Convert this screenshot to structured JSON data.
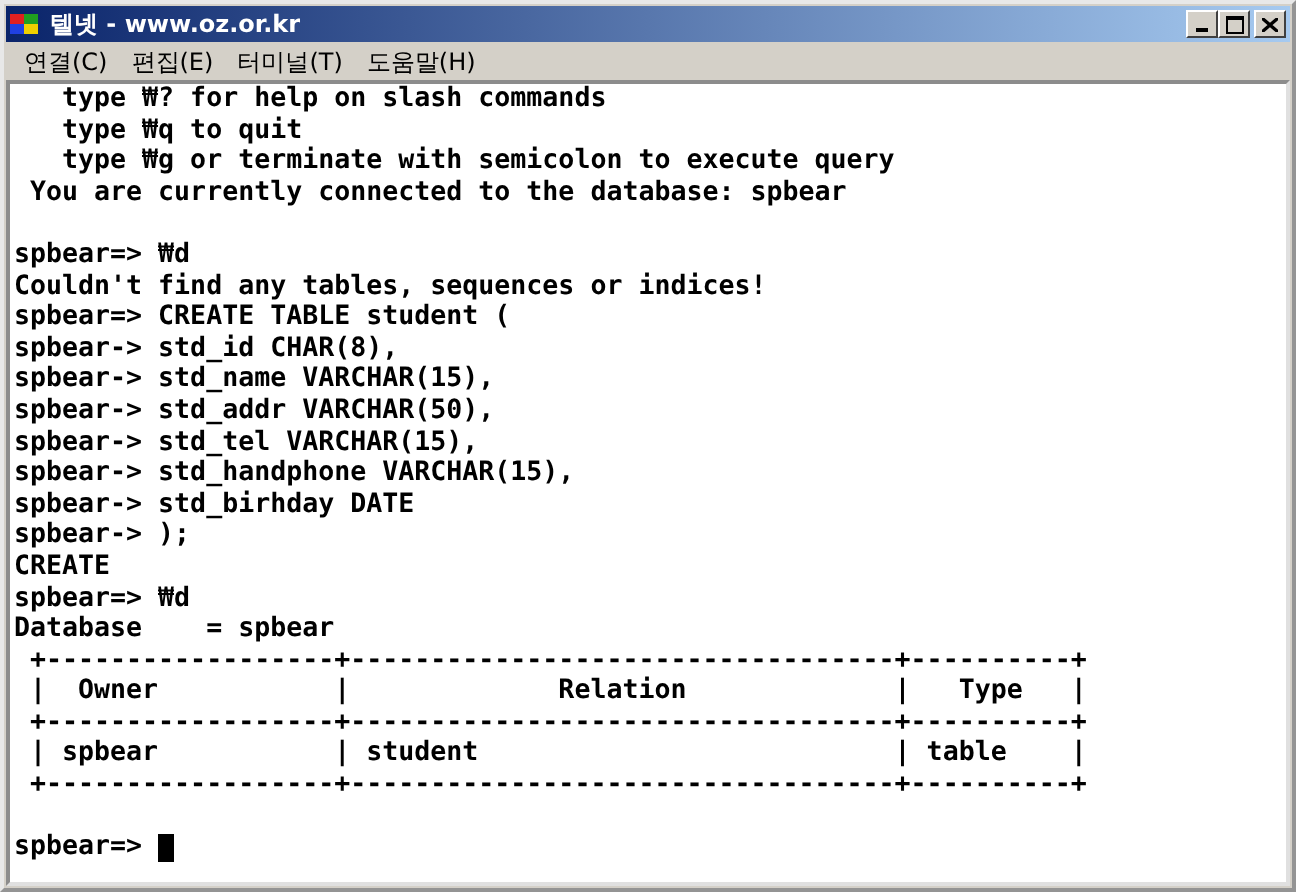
{
  "window": {
    "title": "텔넷 - www.oz.or.kr"
  },
  "menu": [
    {
      "label": "연결(C)"
    },
    {
      "label": "편집(E)"
    },
    {
      "label": "터미널(T)"
    },
    {
      "label": "도움말(H)"
    }
  ],
  "terminal": {
    "lines": [
      {
        "kind": "text",
        "text": "   type ₩? for help on slash commands"
      },
      {
        "kind": "text",
        "text": "   type ₩q to quit"
      },
      {
        "kind": "text",
        "text": "   type ₩g or terminate with semicolon to execute query"
      },
      {
        "kind": "text",
        "text": " You are currently connected to the database: spbear"
      },
      {
        "kind": "blank"
      },
      {
        "kind": "text",
        "text": "spbear=> ₩d"
      },
      {
        "kind": "text",
        "text": "Couldn't find any tables, sequences or indices!"
      },
      {
        "kind": "text",
        "text": "spbear=> CREATE TABLE student ("
      },
      {
        "kind": "text",
        "text": "spbear-> std_id CHAR(8),"
      },
      {
        "kind": "text",
        "text": "spbear-> std_name VARCHAR(15),"
      },
      {
        "kind": "text",
        "text": "spbear-> std_addr VARCHAR(50),"
      },
      {
        "kind": "text",
        "text": "spbear-> std_tel VARCHAR(15),"
      },
      {
        "kind": "text",
        "text": "spbear-> std_handphone VARCHAR(15),"
      },
      {
        "kind": "text",
        "text": "spbear-> std_birhday DATE"
      },
      {
        "kind": "text",
        "text": "spbear-> );"
      },
      {
        "kind": "text",
        "text": "CREATE"
      },
      {
        "kind": "text",
        "text": "spbear=> ₩d"
      },
      {
        "kind": "text",
        "text": "Database    = spbear"
      },
      {
        "kind": "text",
        "text": " +------------------+----------------------------------+----------+"
      },
      {
        "kind": "text",
        "text": " |  Owner           |             Relation             |   Type   |"
      },
      {
        "kind": "text",
        "text": " +------------------+----------------------------------+----------+"
      },
      {
        "kind": "text",
        "text": " | spbear           | student                          | table    |"
      },
      {
        "kind": "text",
        "text": " +------------------+----------------------------------+----------+"
      },
      {
        "kind": "blank"
      },
      {
        "kind": "prompt",
        "text": "spbear=> "
      }
    ]
  }
}
